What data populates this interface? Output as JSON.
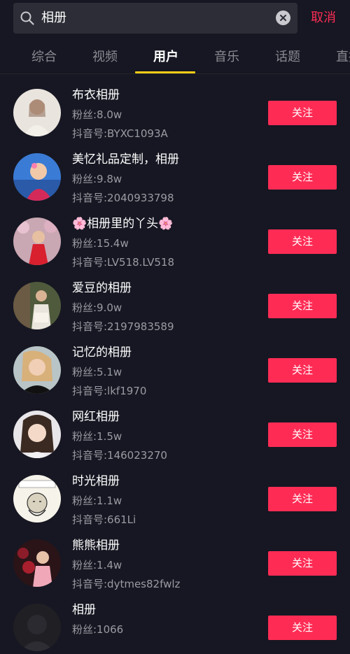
{
  "search": {
    "query": "相册",
    "cancel_label": "取消"
  },
  "tabs": [
    {
      "label": "综合"
    },
    {
      "label": "视频"
    },
    {
      "label": "用户",
      "active": true
    },
    {
      "label": "音乐"
    },
    {
      "label": "话题"
    },
    {
      "label": "直播"
    }
  ],
  "colors": {
    "background": "#161722",
    "accent": "#fe2c55",
    "tab_indicator": "#face15"
  },
  "users": [
    {
      "name": "布衣相册",
      "fans": "粉丝:8.0w",
      "uid": "抖音号:BYXC1093A",
      "follow_label": "关注"
    },
    {
      "name": "美忆礼品定制，相册",
      "fans": "粉丝:9.8w",
      "uid": "抖音号:2040933798",
      "follow_label": "关注"
    },
    {
      "name": "🌸相册里的丫头🌸",
      "fans": "粉丝:15.4w",
      "uid": "抖音号:LV518.LV518",
      "follow_label": "关注"
    },
    {
      "name": "爱豆的相册",
      "fans": "粉丝:9.0w",
      "uid": "抖音号:2197983589",
      "follow_label": "关注"
    },
    {
      "name": "记忆的相册",
      "fans": "粉丝:5.1w",
      "uid": "抖音号:lkf1970",
      "follow_label": "关注"
    },
    {
      "name": "网红相册",
      "fans": "粉丝:1.5w",
      "uid": "抖音号:146023270",
      "follow_label": "关注"
    },
    {
      "name": "时光相册",
      "fans": "粉丝:1.1w",
      "uid": "抖音号:661Li",
      "follow_label": "关注"
    },
    {
      "name": "熊熊相册",
      "fans": "粉丝:1.4w",
      "uid": "抖音号:dytmes82fwlz",
      "follow_label": "关注"
    },
    {
      "name": "相册",
      "fans": "粉丝:1066",
      "uid": "",
      "follow_label": "关注"
    }
  ]
}
